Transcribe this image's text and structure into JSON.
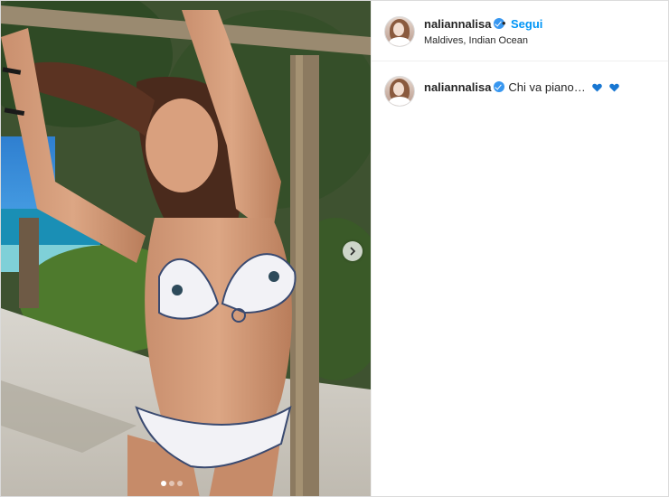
{
  "post": {
    "username": "naliannalisa",
    "separator": "•",
    "follow_label": "Segui",
    "location": "Maldives, Indian Ocean",
    "caption_text": "Chi va piano…",
    "caption_emoji": [
      "blue-heart",
      "blue-heart"
    ]
  },
  "carousel": {
    "total_slides": 3,
    "active_slide": 1
  },
  "colors": {
    "accent": "#0095f6",
    "verified": "#3897f0",
    "heart": "#1877d2"
  }
}
